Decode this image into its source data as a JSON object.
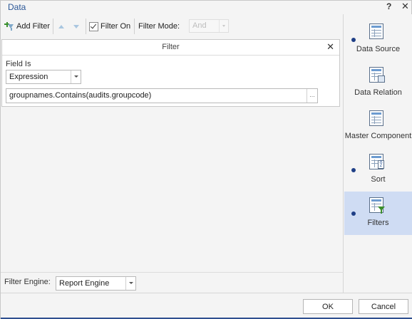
{
  "window": {
    "title": "Data",
    "help_label": "?",
    "close_label": "✕"
  },
  "toolbar": {
    "add_filter_label": "Add Filter",
    "filter_on_label": "Filter On",
    "filter_on_checked": true,
    "filter_mode_label": "Filter Mode:",
    "filter_mode_value": "And"
  },
  "filter_panel": {
    "header": "Filter",
    "close_label": "✕",
    "field_is_label": "Field Is",
    "type_value": "Expression",
    "expression_value": "groupnames.Contains(audits.groupcode)",
    "ellipsis_label": "..."
  },
  "engine": {
    "label": "Filter Engine:",
    "value": "Report Engine"
  },
  "nav": {
    "items": [
      {
        "label": "Data Source",
        "dot": true,
        "active": false
      },
      {
        "label": "Data Relation",
        "dot": false,
        "active": false
      },
      {
        "label": "Master Component",
        "dot": false,
        "active": false
      },
      {
        "label": "Sort",
        "dot": true,
        "active": false
      },
      {
        "label": "Filters",
        "dot": true,
        "active": true
      }
    ]
  },
  "footer": {
    "ok_label": "OK",
    "cancel_label": "Cancel"
  },
  "colors": {
    "accent": "#2b5797",
    "active_nav": "#cfdcf3",
    "dot": "#1f3f86"
  }
}
